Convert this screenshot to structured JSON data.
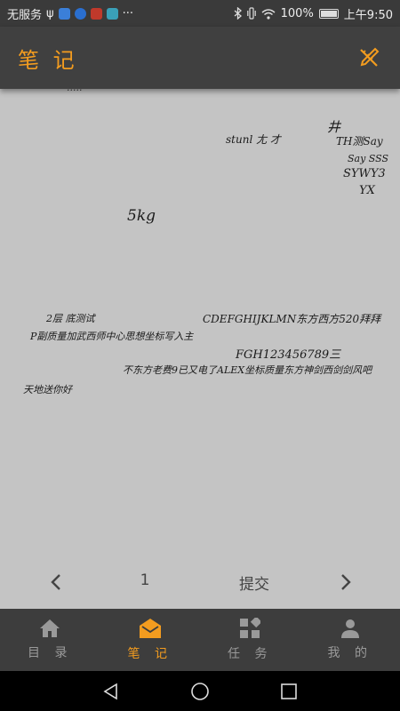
{
  "status_bar": {
    "carrier": "无服务",
    "usb_icon": "ψ",
    "more": "···",
    "battery_text": "100%",
    "time": "上午9:50"
  },
  "app_bar": {
    "title": "笔 记",
    "edit_icon": "pencil-ruler-icon",
    "accent": "#f39c1f"
  },
  "note": {
    "lines": [
      "stunl 尢   才",
      "井",
      "TH测Say",
      "Say SSS",
      "SYWY3",
      "YX",
      "5kg",
      "2层 底测试",
      "CDEFGHIJKLMN东方西方520拜拜",
      "P副质量加武西师中心思想坐标写入主",
      "FGH123456789三",
      "不东方老费9已又电了ALEX坐标质量东方神剑西剑剑风吧",
      "天地送你好"
    ]
  },
  "pager": {
    "prev_icon": "chevron-left-icon",
    "page": "1",
    "submit": "提交",
    "next_icon": "chevron-right-icon"
  },
  "bottom_nav": [
    {
      "label": "目 录",
      "icon": "home-icon",
      "active": false
    },
    {
      "label": "笔 记",
      "icon": "envelope-open-icon",
      "active": true
    },
    {
      "label": "任 务",
      "icon": "grid-icon",
      "active": false
    },
    {
      "label": "我 的",
      "icon": "person-icon",
      "active": false
    }
  ],
  "system_nav": [
    "back-icon",
    "home-circle-icon",
    "recents-icon"
  ]
}
